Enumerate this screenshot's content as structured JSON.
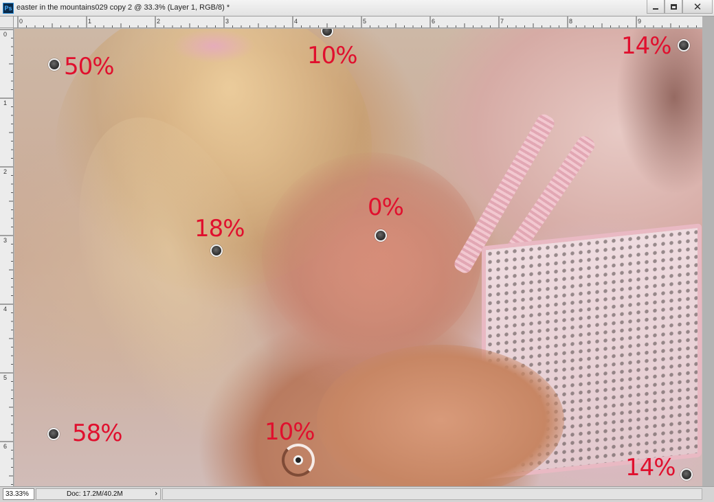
{
  "window": {
    "app_icon": "Ps",
    "title": "easter in the mountains029 copy 2 @ 33.3% (Layer 1, RGB/8) *",
    "minimize_icon": "minimize-icon",
    "maximize_icon": "maximize-icon",
    "close_label": "✕"
  },
  "rulers": {
    "horizontal_labels": [
      "0",
      "1",
      "2",
      "3",
      "4",
      "5",
      "6",
      "7",
      "8",
      "9"
    ],
    "vertical_labels": [
      "0",
      "1",
      "2",
      "3",
      "4",
      "5",
      "6"
    ]
  },
  "samples": [
    {
      "id": "top-left",
      "label": "50%"
    },
    {
      "id": "top-center",
      "label": "10%"
    },
    {
      "id": "top-right",
      "label": "14%"
    },
    {
      "id": "mid-left",
      "label": "18%"
    },
    {
      "id": "mid-center",
      "label": "0%"
    },
    {
      "id": "bottom-left",
      "label": "58%"
    },
    {
      "id": "bottom-center",
      "label": "10%"
    },
    {
      "id": "bottom-right",
      "label": "14%"
    }
  ],
  "status": {
    "zoom": "33.33%",
    "doc_info": "Doc: 17.2M/40.2M",
    "menu_arrow": "›"
  }
}
